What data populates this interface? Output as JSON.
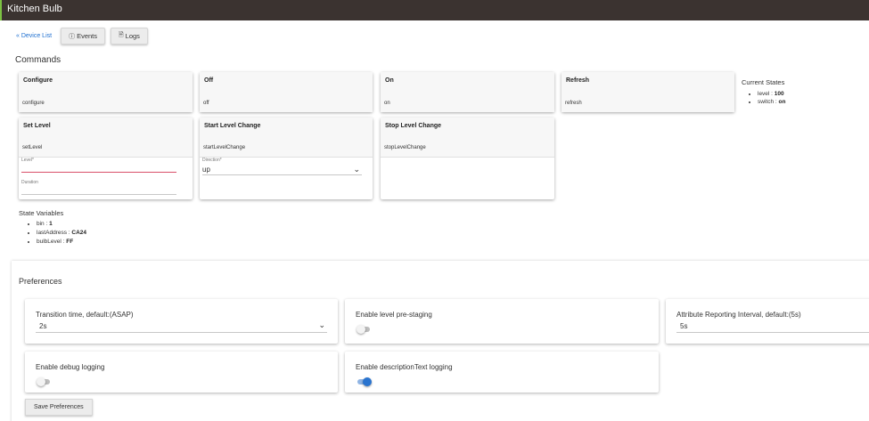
{
  "window": {
    "title": "Kitchen Bulb"
  },
  "toolbar": {
    "device_list_label": "« Device List",
    "events_label": "Events",
    "logs_label": "Logs",
    "events_icon": "info-circle-icon",
    "logs_icon": "document-icon"
  },
  "commands": {
    "heading": "Commands",
    "cards": [
      {
        "name": "Configure",
        "method": "configure"
      },
      {
        "name": "Off",
        "method": "off"
      },
      {
        "name": "On",
        "method": "on"
      },
      {
        "name": "Refresh",
        "method": "refresh"
      },
      {
        "name": "Set Level",
        "method": "setLevel",
        "fields": [
          {
            "label": "Level*",
            "value": ""
          },
          {
            "label": "Duration",
            "value": ""
          }
        ]
      },
      {
        "name": "Start Level Change",
        "method": "startLevelChange",
        "select": {
          "label": "Direction*",
          "value": "up"
        }
      },
      {
        "name": "Stop Level Change",
        "method": "stopLevelChange"
      }
    ]
  },
  "current_states": {
    "heading": "Current States",
    "items": [
      {
        "key": "level",
        "value": "100"
      },
      {
        "key": "switch",
        "value": "on"
      }
    ]
  },
  "state_variables": {
    "heading": "State Variables",
    "items": [
      {
        "key": "bin",
        "value": "1"
      },
      {
        "key": "lastAddress",
        "value": "CA24"
      },
      {
        "key": "bulbLevel",
        "value": "FF"
      }
    ]
  },
  "preferences": {
    "heading": "Preferences",
    "transition": {
      "label": "Transition time, default:(ASAP)",
      "value": "2s"
    },
    "prestaging": {
      "label": "Enable level pre-staging",
      "enabled": false
    },
    "reporting": {
      "label": "Attribute Reporting Interval, default:(5s)",
      "value": "5s"
    },
    "debug": {
      "label": "Enable debug logging",
      "enabled": false
    },
    "desc_text": {
      "label": "Enable descriptionText logging",
      "enabled": true
    },
    "save_label": "Save Preferences"
  },
  "colors": {
    "titlebar": "#3b3330",
    "accent": "#7cc242",
    "link": "#1e6fd0",
    "toggle_on": "#2a74cf",
    "error_line": "#d9506a"
  }
}
